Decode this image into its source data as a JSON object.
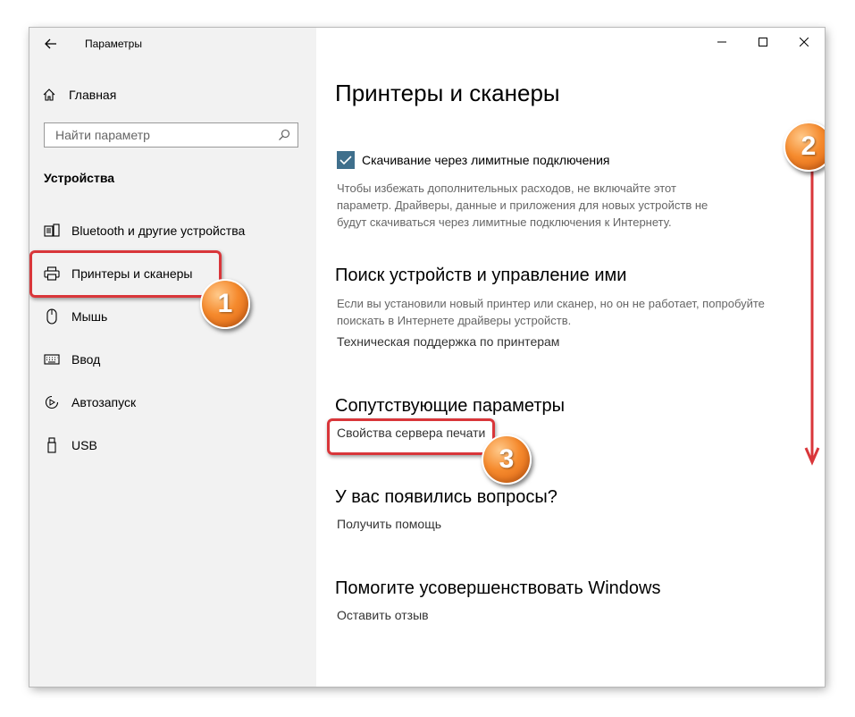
{
  "window": {
    "title": "Параметры",
    "controls": {
      "minimize": "—",
      "maximize": "☐",
      "close": "✕"
    }
  },
  "sidebar": {
    "home_label": "Главная",
    "search": {
      "placeholder": "Найти параметр",
      "value": ""
    },
    "section_title": "Устройства",
    "items": [
      {
        "label": "Bluetooth и другие устройства",
        "icon": "bluetooth-devices-icon"
      },
      {
        "label": "Принтеры и сканеры",
        "icon": "printer-icon",
        "selected": true
      },
      {
        "label": "Мышь",
        "icon": "mouse-icon"
      },
      {
        "label": "Ввод",
        "icon": "keyboard-icon"
      },
      {
        "label": "Автозапуск",
        "icon": "autoplay-icon"
      },
      {
        "label": "USB",
        "icon": "usb-icon"
      }
    ]
  },
  "main": {
    "title": "Принтеры и сканеры",
    "metered": {
      "checkbox_label": "Скачивание через лимитные подключения",
      "checked": true,
      "description_lines": [
        "Чтобы избежать дополнительных расходов, не включайте этот",
        "параметр. Драйверы, данные и приложения для новых устройств не",
        "будут скачиваться через лимитные подключения к Интернету."
      ]
    },
    "find_devices": {
      "heading": "Поиск устройств и управление ими",
      "description_lines": [
        "Если вы установили новый принтер или сканер, но он не работает, попробуйте",
        "поискать в Интернете драйверы устройств."
      ],
      "link": "Техническая поддержка по принтерам"
    },
    "related": {
      "heading": "Сопутствующие параметры",
      "link": "Свойства сервера печати"
    },
    "questions": {
      "heading": "У вас появились вопросы?",
      "link": "Получить помощь"
    },
    "improve": {
      "heading": "Помогите усовершенствовать Windows",
      "link": "Оставить отзыв"
    }
  },
  "annotations": {
    "badge_1": "1",
    "badge_2": "2",
    "badge_3": "3",
    "highlight_color": "#d9363a",
    "badge_color": "#f58a2d"
  }
}
